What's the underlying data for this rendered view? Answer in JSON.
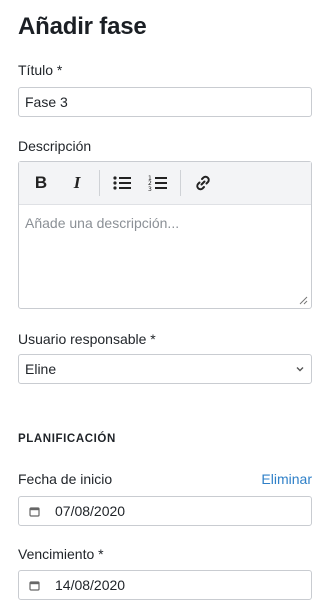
{
  "dialog": {
    "title": "Añadir fase"
  },
  "title_field": {
    "label": "Título *",
    "value": "Fase 3"
  },
  "description": {
    "label": "Descripción",
    "placeholder": "Añade una descripción...",
    "toolbar": {
      "bold": "B",
      "italic": "I",
      "icons": [
        "bold-icon",
        "italic-icon",
        "bullet-list-icon",
        "numbered-list-icon",
        "link-icon"
      ]
    }
  },
  "responsible": {
    "label": "Usuario responsable *",
    "value": "Eline"
  },
  "planning": {
    "heading": "PLANIFICACIÓN",
    "start_date": {
      "label": "Fecha de inicio",
      "action": "Eliminar",
      "value": "07/08/2020"
    },
    "due_date": {
      "label": "Vencimiento *",
      "value": "14/08/2020"
    }
  },
  "colors": {
    "link": "#2f80c8",
    "border": "#c9ccd1",
    "toolbar_bg": "#f3f4f6",
    "placeholder": "#8b9096"
  }
}
